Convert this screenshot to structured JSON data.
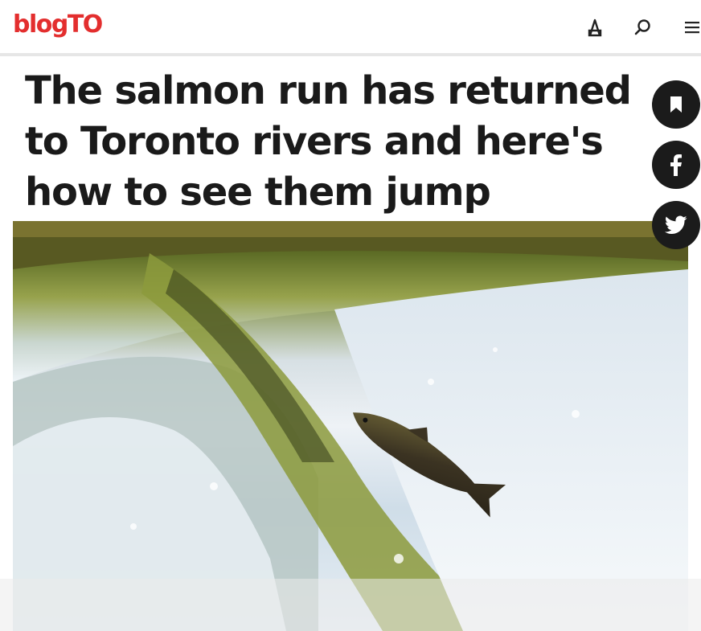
{
  "site": {
    "logo_text": "blogTO",
    "brand_color": "#e32e2e"
  },
  "header": {
    "icons": [
      "user-icon",
      "search-icon",
      "hamburger-menu-icon"
    ]
  },
  "article": {
    "headline": "The salmon run has returned to Toronto rivers and here's how to see them jump",
    "hero_image": "salmon-jumping-waterfall-photo"
  },
  "share": {
    "icons": [
      "bookmark-icon",
      "facebook-icon",
      "twitter-icon"
    ],
    "button_color": "#1b1b1b"
  }
}
